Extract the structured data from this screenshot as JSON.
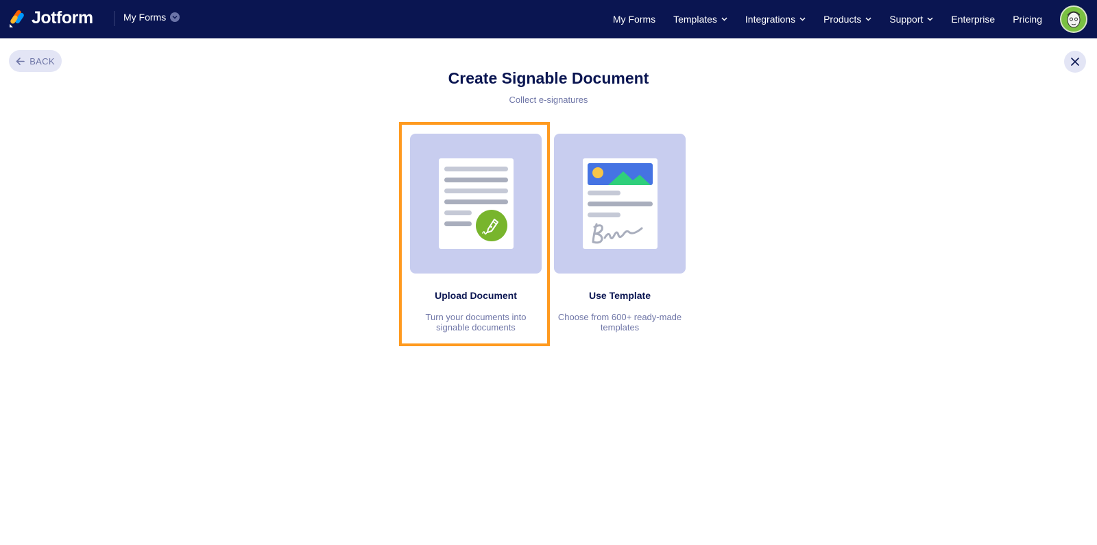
{
  "header": {
    "brand": "Jotform",
    "my_forms_dropdown": "My Forms",
    "nav": [
      {
        "label": "My Forms",
        "has_chevron": false
      },
      {
        "label": "Templates",
        "has_chevron": true
      },
      {
        "label": "Integrations",
        "has_chevron": true
      },
      {
        "label": "Products",
        "has_chevron": true
      },
      {
        "label": "Support",
        "has_chevron": true
      },
      {
        "label": "Enterprise",
        "has_chevron": false
      },
      {
        "label": "Pricing",
        "has_chevron": false
      }
    ]
  },
  "back_label": "BACK",
  "page": {
    "title": "Create Signable Document",
    "subtitle": "Collect e-signatures"
  },
  "cards": {
    "upload": {
      "label": "Upload Document",
      "desc_line1": "Turn your documents into",
      "desc_line2": "signable documents",
      "selected": true
    },
    "template": {
      "label": "Use Template",
      "desc_line1": "Choose from 600+ ready-made",
      "desc_line2": "templates"
    }
  },
  "colors": {
    "header_bg": "#0a1551",
    "card_bg": "#c8cdef",
    "highlight": "#ff9a1f",
    "accent_green": "#78b52c",
    "muted_text": "#6f76a7"
  }
}
